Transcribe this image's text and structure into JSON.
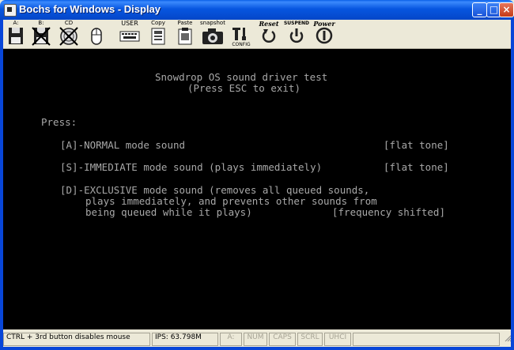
{
  "window": {
    "title": "Bochs for Windows - Display"
  },
  "toolbar": {
    "drive_a": "A:",
    "drive_b": "B:",
    "cdrom": "CD",
    "user": "USER",
    "copy": "Copy",
    "paste": "Paste",
    "snapshot": "snapshot",
    "config": "CONFIG",
    "reset": "Reset",
    "suspend": "SUSPEND",
    "power": "Power"
  },
  "screen": {
    "lines": [
      "Snowdrop OS sound driver test",
      "(Press ESC to exit)",
      "Press:",
      "[A]-NORMAL mode sound",
      "[flat tone]",
      "[S]-IMMEDIATE mode sound (plays immediately)",
      "[flat tone]",
      "[D]-EXCLUSIVE mode sound (removes all queued sounds,",
      "plays immediately, and prevents other sounds from",
      "being queued while it plays)",
      "[frequency shifted]"
    ]
  },
  "statusbar": {
    "hint": "CTRL + 3rd button disables mouse",
    "ips": "IPS: 63.798M",
    "drive": "A:",
    "num": "NUM",
    "caps": "CAPS",
    "scrl": "SCRL",
    "uhci": "UHCI"
  }
}
